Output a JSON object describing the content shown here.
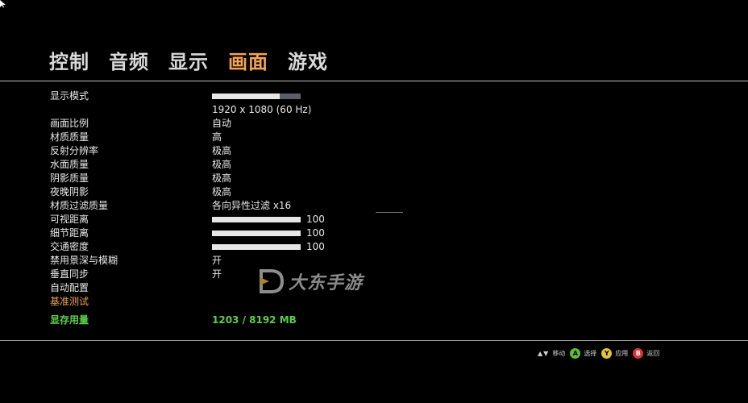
{
  "tabs": [
    {
      "label": "控制",
      "active": false
    },
    {
      "label": "音频",
      "active": false
    },
    {
      "label": "显示",
      "active": false
    },
    {
      "label": "画面",
      "active": true
    },
    {
      "label": "游戏",
      "active": false
    }
  ],
  "colors": {
    "accent": "#f2a355",
    "vram": "#5ccf4a",
    "btn_a": "#5bbf3a",
    "btn_y": "#e4c23a",
    "btn_b": "#d8343c"
  },
  "settings": {
    "display_mode": {
      "label": "显示模式",
      "value": "1920 x 1080 (60 Hz)",
      "level": 0.76
    },
    "aspect": {
      "label": "画面比例",
      "value": "自动"
    },
    "texture": {
      "label": "材质质量",
      "value": "高"
    },
    "reflection": {
      "label": "反射分辨率",
      "value": "极高"
    },
    "water": {
      "label": "水面质量",
      "value": "极高"
    },
    "shadow": {
      "label": "阴影质量",
      "value": "极高"
    },
    "night_shadow": {
      "label": "夜晚阴影",
      "value": "极高"
    },
    "filter": {
      "label": "材质过滤质量",
      "value": "各向异性过滤 x16"
    },
    "view_distance": {
      "label": "可视距离",
      "value": "100",
      "level": 1.0
    },
    "detail_distance": {
      "label": "细节距离",
      "value": "100",
      "level": 1.0
    },
    "traffic_density": {
      "label": "交通密度",
      "value": "100",
      "level": 1.0
    },
    "dof_blur": {
      "label": "禁用景深与模糊",
      "value": "开"
    },
    "vsync": {
      "label": "垂直同步",
      "value": "开"
    },
    "auto_config": {
      "label": "自动配置"
    },
    "benchmark": {
      "label": "基准测试"
    },
    "vram": {
      "label": "显存用量",
      "value": "1203 / 8192 MB"
    }
  },
  "watermark": {
    "text": "大东手游"
  },
  "hints": {
    "move": "移动",
    "select": {
      "key": "A",
      "label": "选择"
    },
    "apply": {
      "key": "Y",
      "label": "应用"
    },
    "back": {
      "key": "B",
      "label": "返回"
    }
  }
}
